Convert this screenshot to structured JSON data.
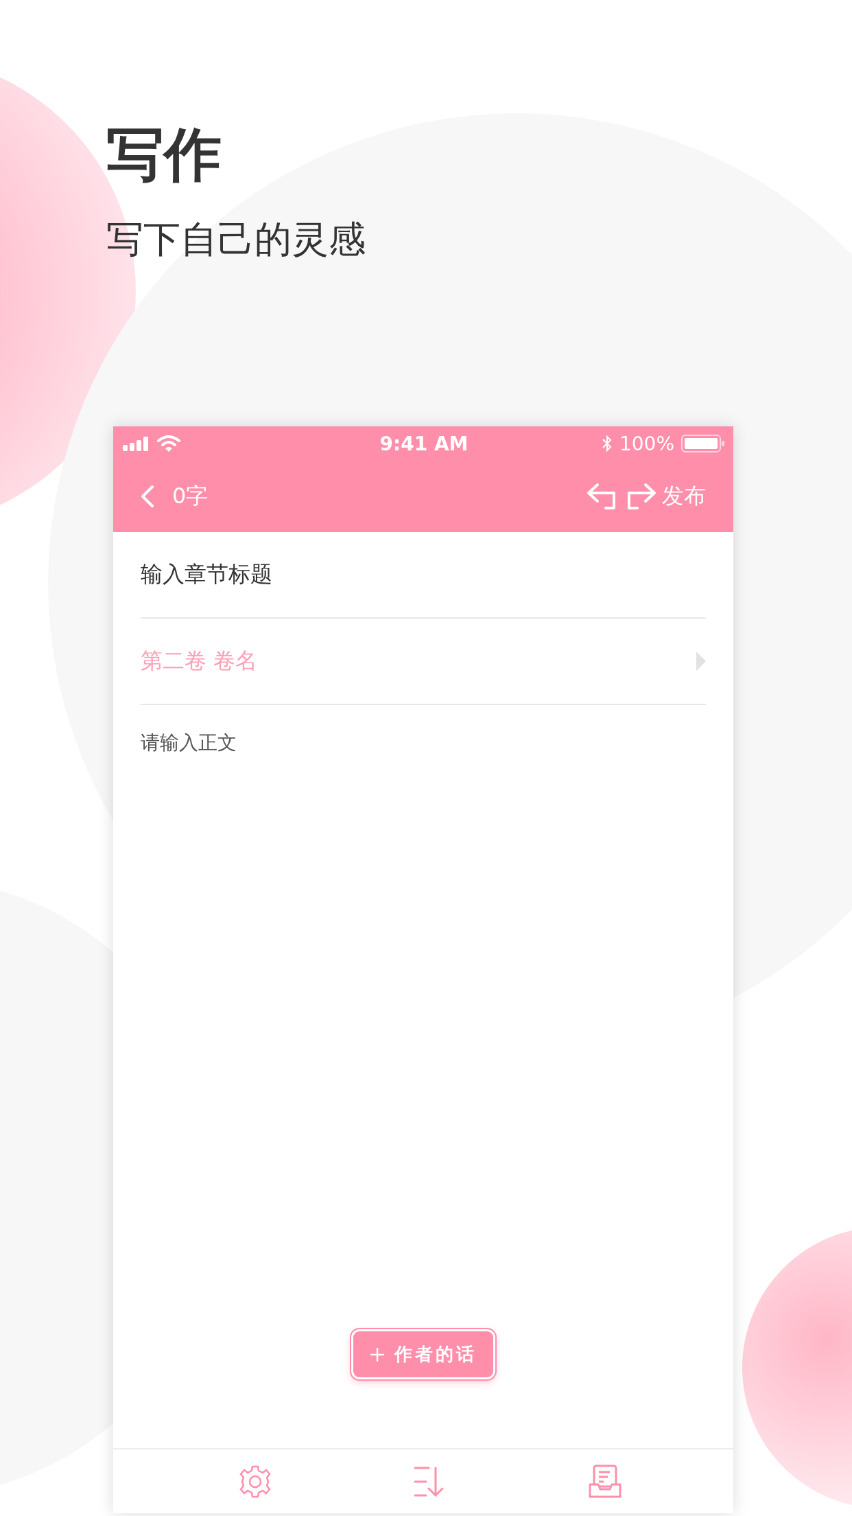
{
  "headline": "写作",
  "subtitle": "写下自己的灵感",
  "status_bar": {
    "time": "9:41 AM",
    "battery": "100%"
  },
  "nav": {
    "word_count": "0字",
    "publish": "发布"
  },
  "title_field": {
    "placeholder": "输入章节标题"
  },
  "volume": {
    "label": "第二卷  卷名"
  },
  "body_field": {
    "placeholder": "请输入正文"
  },
  "author_note_button": {
    "label": "作者的话"
  }
}
